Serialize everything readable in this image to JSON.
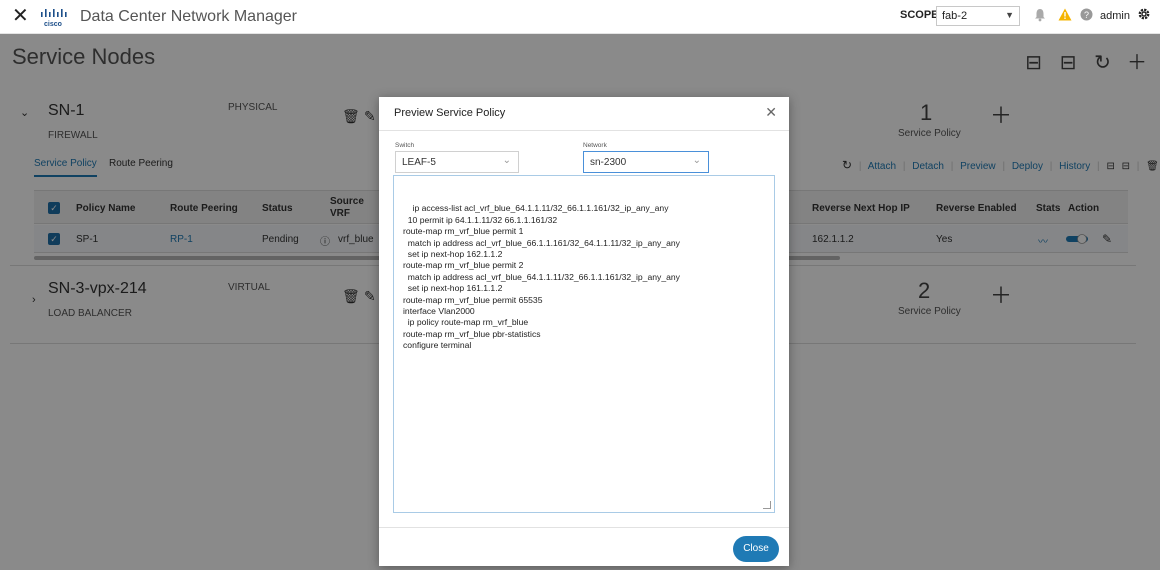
{
  "header": {
    "app_title": "Data Center Network Manager",
    "scope_label": "SCOPE:",
    "scope_value": "fab-2",
    "user": "admin"
  },
  "page": {
    "title": "Service Nodes"
  },
  "nodes": [
    {
      "name": "SN-1",
      "node_type": "FIREWALL",
      "attachment": "PHYSICAL",
      "service_policy_count": "1",
      "service_policy_label": "Service Policy"
    },
    {
      "name": "SN-3-vpx-214",
      "node_type": "LOAD BALANCER",
      "attachment": "VIRTUAL",
      "service_policy_count": "2",
      "service_policy_label": "Service Policy"
    }
  ],
  "tabs": [
    "Service Policy",
    "Route Peering"
  ],
  "toolbar": {
    "links": [
      "Attach",
      "Detach",
      "Preview",
      "Deploy",
      "History"
    ]
  },
  "table": {
    "columns": {
      "policy_name": "Policy Name",
      "route_peering": "Route Peering",
      "status": "Status",
      "source_vrf": "Source VRF",
      "reverse_next_hop": "Reverse Next Hop IP",
      "reverse_enabled": "Reverse Enabled",
      "stats": "Stats",
      "action": "Action"
    },
    "rows": [
      {
        "policy_name": "SP-1",
        "route_peering": "RP-1",
        "status": "Pending",
        "source_vrf": "vrf_blue",
        "reverse_next_hop": "162.1.1.2",
        "reverse_enabled": "Yes"
      }
    ]
  },
  "modal": {
    "title": "Preview Service Policy",
    "switch_label": "Switch",
    "switch_value": "LEAF-5",
    "network_label": "Network",
    "network_value": "sn-2300",
    "policy_text": "ip access-list acl_vrf_blue_64.1.1.11/32_66.1.1.161/32_ip_any_any\n  10 permit ip 64.1.1.11/32 66.1.1.161/32\nroute-map rm_vrf_blue permit 1\n  match ip address acl_vrf_blue_66.1.1.161/32_64.1.1.11/32_ip_any_any\n  set ip next-hop 162.1.1.2\nroute-map rm_vrf_blue permit 2\n  match ip address acl_vrf_blue_64.1.1.11/32_66.1.1.161/32_ip_any_any\n  set ip next-hop 161.1.1.2\nroute-map rm_vrf_blue permit 65535\ninterface Vlan2000\n  ip policy route-map rm_vrf_blue\nroute-map rm_vrf_blue pbr-statistics\nconfigure terminal",
    "close_button": "Close"
  },
  "colors": {
    "accent": "#1f7ab5",
    "warning": "#f5b400",
    "overlay": "#767676"
  }
}
